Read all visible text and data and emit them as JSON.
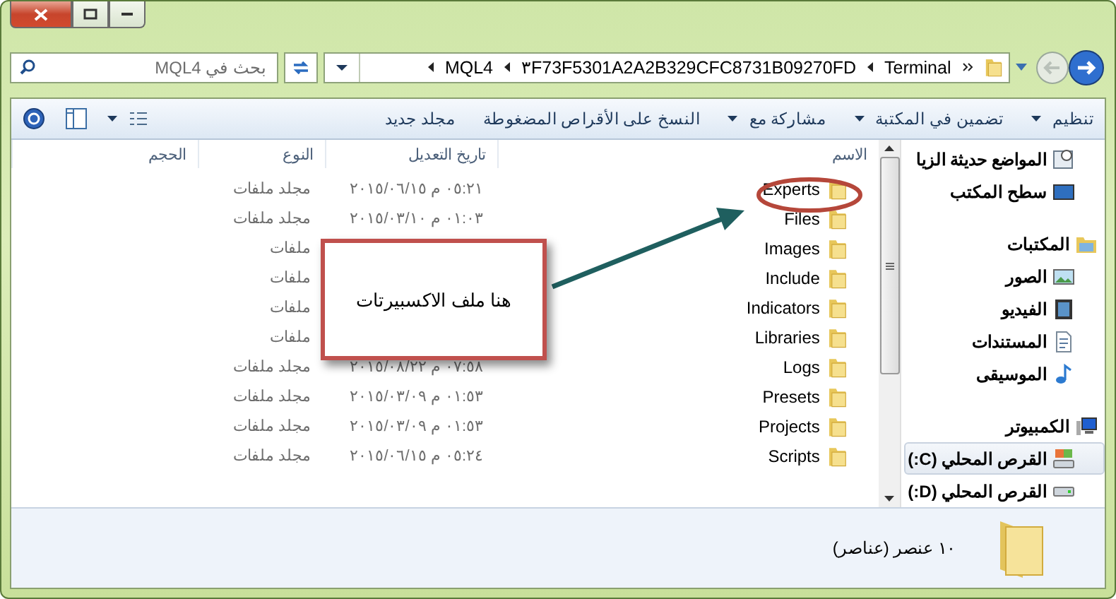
{
  "address_bar": {
    "crumbs": [
      "Terminal",
      "٣F73F5301A2A2B329CFC8731B09270FD",
      "MQL4"
    ]
  },
  "search": {
    "placeholder": "بحث في MQL4"
  },
  "toolbar": {
    "items": [
      {
        "label": "تنظيم",
        "dropdown": true
      },
      {
        "label": "تضمين في المكتبة",
        "dropdown": true
      },
      {
        "label": "مشاركة مع",
        "dropdown": true
      },
      {
        "label": "النسخ على الأقراص المضغوطة",
        "dropdown": false
      },
      {
        "label": "مجلد جديد",
        "dropdown": false
      }
    ]
  },
  "file_list": {
    "columns": [
      "الاسم",
      "تاريخ التعديل",
      "النوع",
      "الحجم"
    ],
    "rows": [
      {
        "name": "Experts",
        "date": "٠٥:٢١ م ٢٠١٥/٠٦/١٥",
        "type": "مجلد ملفات"
      },
      {
        "name": "Files",
        "date": "٠١:٠٣ م ٢٠١٥/٠٣/١٠",
        "type": "مجلد ملفات"
      },
      {
        "name": "Images",
        "type": "ملفات"
      },
      {
        "name": "Include",
        "type": "ملفات"
      },
      {
        "name": "Indicators",
        "type": "ملفات"
      },
      {
        "name": "Libraries",
        "type": "ملفات"
      },
      {
        "name": "Logs",
        "date": "٠٧:٥٨ م ٢٠١٥/٠٨/٢٢",
        "type": "مجلد ملفات"
      },
      {
        "name": "Presets",
        "date": "٠١:٥٣ م ٢٠١٥/٠٣/٠٩",
        "type": "مجلد ملفات"
      },
      {
        "name": "Projects",
        "date": "٠١:٥٣ م ٢٠١٥/٠٣/٠٩",
        "type": "مجلد ملفات"
      },
      {
        "name": "Scripts",
        "date": "٠٥:٢٤ م ٢٠١٥/٠٦/١٥",
        "type": "مجلد ملفات"
      }
    ]
  },
  "callout": {
    "text": "هنا ملف الاكسبيرتات"
  },
  "nav_pane": {
    "sections": [
      {
        "items": [
          {
            "label": "المواضع حديثة الزيا",
            "kind": "recent",
            "selected": false
          },
          {
            "label": "سطح المكتب",
            "kind": "desktop",
            "selected": false
          }
        ]
      },
      {
        "heading": {
          "label": "المكتبات",
          "kind": "libraries",
          "selected": false
        },
        "items": [
          {
            "label": "الصور",
            "kind": "pictures",
            "selected": false
          },
          {
            "label": "الفيديو",
            "kind": "videos",
            "selected": false
          },
          {
            "label": "المستندات",
            "kind": "documents",
            "selected": false
          },
          {
            "label": "الموسيقى",
            "kind": "music",
            "selected": false
          }
        ]
      },
      {
        "heading": {
          "label": "الكمبيوتر",
          "kind": "computer",
          "selected": false
        },
        "items": [
          {
            "label": "القرص المحلي (C:)",
            "kind": "system_drive",
            "selected": true
          },
          {
            "label": "القرص المحلي (D:)",
            "kind": "drive",
            "selected": false
          }
        ]
      }
    ]
  },
  "status_bar": {
    "text": "١٠ عنصر (عناصر)"
  }
}
